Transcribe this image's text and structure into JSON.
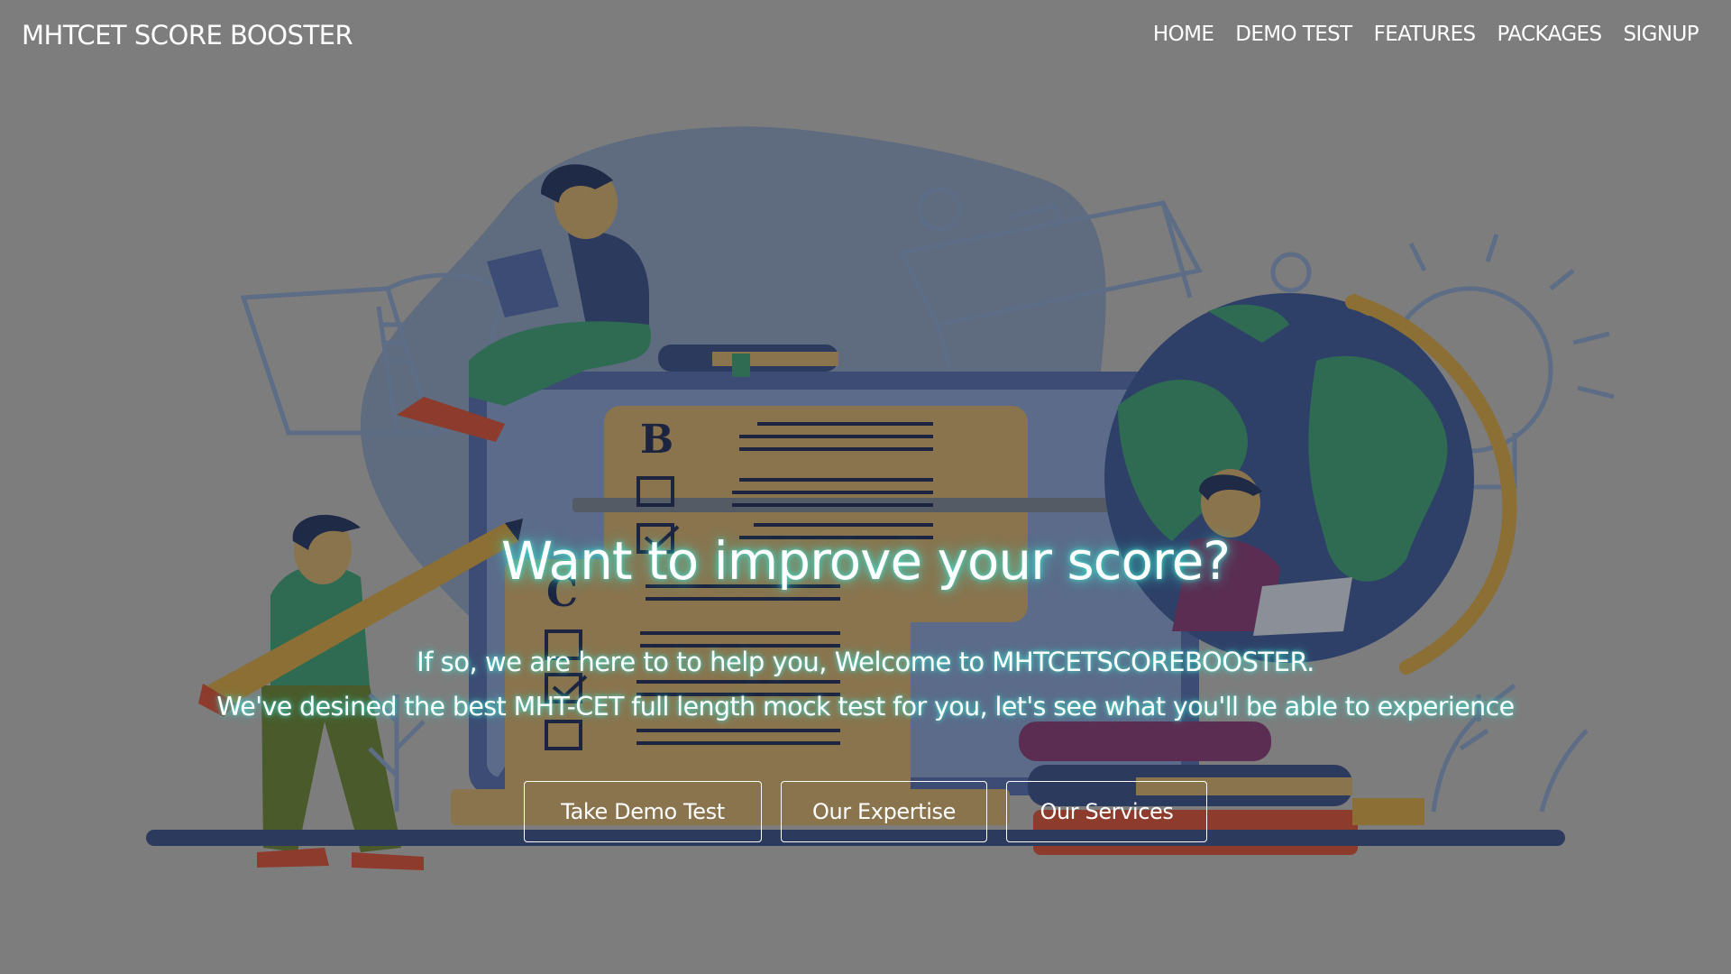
{
  "brand": {
    "name": "MHTCET SCORE BOOSTER"
  },
  "nav": {
    "items": [
      "HOME",
      "DEMO TEST",
      "FEATURES",
      "PACKAGES",
      "SIGNUP"
    ]
  },
  "hero": {
    "title": "Want to improve your score?",
    "subtitle_line1": "If so, we are here to to help you, Welcome to MHTCETSCOREBOOSTER.",
    "subtitle_line2": "We've desined the best MHT-CET full length mock test for you, let's see what you'll be able to experience",
    "buttons": {
      "demo": "Take Demo Test",
      "expertise": "Our Expertise",
      "services": "Our Services"
    }
  },
  "illustration": {
    "exam_sheet_letter_top": "B",
    "exam_sheet_letter_bottom": "C"
  },
  "colors": {
    "page_overlay": "#7d7d7d",
    "blob": "#5f6b7f",
    "navy": "#2c3a5e",
    "paper": "#8a744e",
    "green": "#2e6b52",
    "globe_ocean": "#2f4068",
    "globe_ring": "#8c6f34",
    "glow": "#40e0d0",
    "text": "#ffffff"
  }
}
